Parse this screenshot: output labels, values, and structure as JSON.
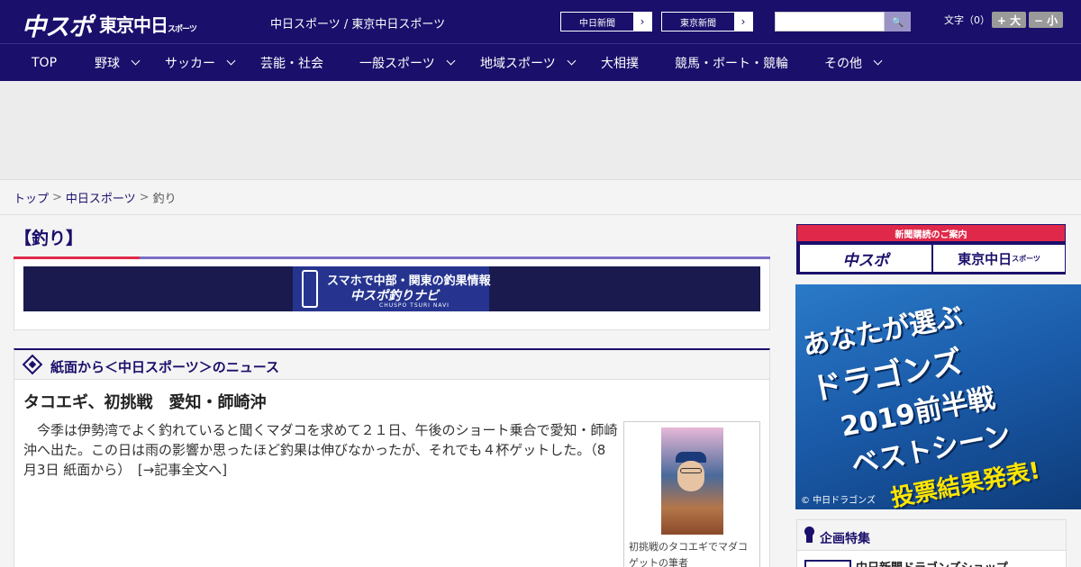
{
  "header": {
    "logo_chuspo": "中スポ",
    "logo_tokyo": "東京中日",
    "logo_tokyo_small": "スポーツ",
    "sites": "中日スポーツ / 東京中日スポーツ",
    "ext_links": [
      {
        "label": "中日新聞",
        "arrow": "›"
      },
      {
        "label": "東京新聞",
        "arrow": "›"
      }
    ],
    "search_placeholder": "",
    "search_icon": "🔍",
    "font_size_label": "文字（0）",
    "font_bigger": "+ 大",
    "font_smaller": "− 小"
  },
  "nav": [
    {
      "label": "TOP",
      "dropdown": false
    },
    {
      "label": "野球",
      "dropdown": true
    },
    {
      "label": "サッカー",
      "dropdown": true
    },
    {
      "label": "芸能・社会",
      "dropdown": false
    },
    {
      "label": "一般スポーツ",
      "dropdown": true
    },
    {
      "label": "地域スポーツ",
      "dropdown": true
    },
    {
      "label": "大相撲",
      "dropdown": false
    },
    {
      "label": "競馬・ボート・競輪",
      "dropdown": false
    },
    {
      "label": "その他",
      "dropdown": true
    }
  ],
  "breadcrumb": {
    "top": "トップ",
    "section": "中日スポーツ",
    "current": "釣り",
    "sep": ">"
  },
  "page_title": "【釣り】",
  "banner": {
    "line1": "スマホで中部・関東の釣果情報",
    "line2": "中スポ釣りナビ",
    "line3": "CHUSPO TSURI NAVI"
  },
  "news": {
    "heading": "紙面から＜中日スポーツ＞のニュース",
    "article_title": "タコエギ、初挑戦　愛知・師崎沖",
    "article_body": "　今季は伊勢湾でよく釣れていると聞くマダコを求めて２１日、午後のショート乗合で愛知・師崎沖へ出た。この日は雨の影響か思ったほど釣果は伸びなかったが、それでも４杯ゲットした。（8月3日 紙面から）　",
    "read_more": "[→記事全文へ]",
    "photo_caption": "初挑戦のタコエギでマダコゲットの筆者"
  },
  "sidebar": {
    "subscribe_head": "新聞購読のご案内",
    "subscribe_chuspo": "中スポ",
    "subscribe_tokyo": "東京中日",
    "subscribe_tokyo_small": "スポーツ",
    "promo_lines": [
      "あなたが選ぶ",
      "ドラゴンズ",
      "2019前半戦",
      "ベストシーン",
      "投票結果発表!"
    ],
    "promo_copyright": "© 中日ドラゴンズ",
    "feature_title": "企画特集",
    "feature_item": "中日新聞ドラゴンズショップ"
  },
  "colors": {
    "brand": "#1a0f6b",
    "accent_red": "#e0294a"
  }
}
